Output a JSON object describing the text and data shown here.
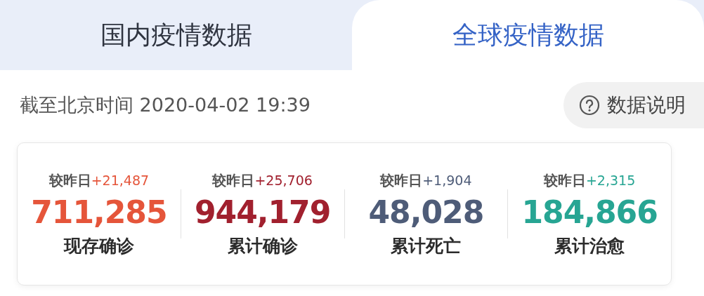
{
  "tabs": [
    {
      "label": "国内疫情数据",
      "selected": false
    },
    {
      "label": "全球疫情数据",
      "selected": true
    }
  ],
  "update_time": "截至北京时间 2020-04-02 19:39",
  "info_button": {
    "label": "数据说明"
  },
  "stats": [
    {
      "delta_label": "较昨日",
      "delta": "+21,487",
      "value": "711,285",
      "label": "现存确诊",
      "color": "#e5553a"
    },
    {
      "delta_label": "较昨日",
      "delta": "+25,706",
      "value": "944,179",
      "label": "累计确诊",
      "color": "#a1202e"
    },
    {
      "delta_label": "较昨日",
      "delta": "+1,904",
      "value": "48,028",
      "label": "累计死亡",
      "color": "#4e5c78"
    },
    {
      "delta_label": "较昨日",
      "delta": "+2,315",
      "value": "184,866",
      "label": "累计治愈",
      "color": "#27a593"
    }
  ]
}
